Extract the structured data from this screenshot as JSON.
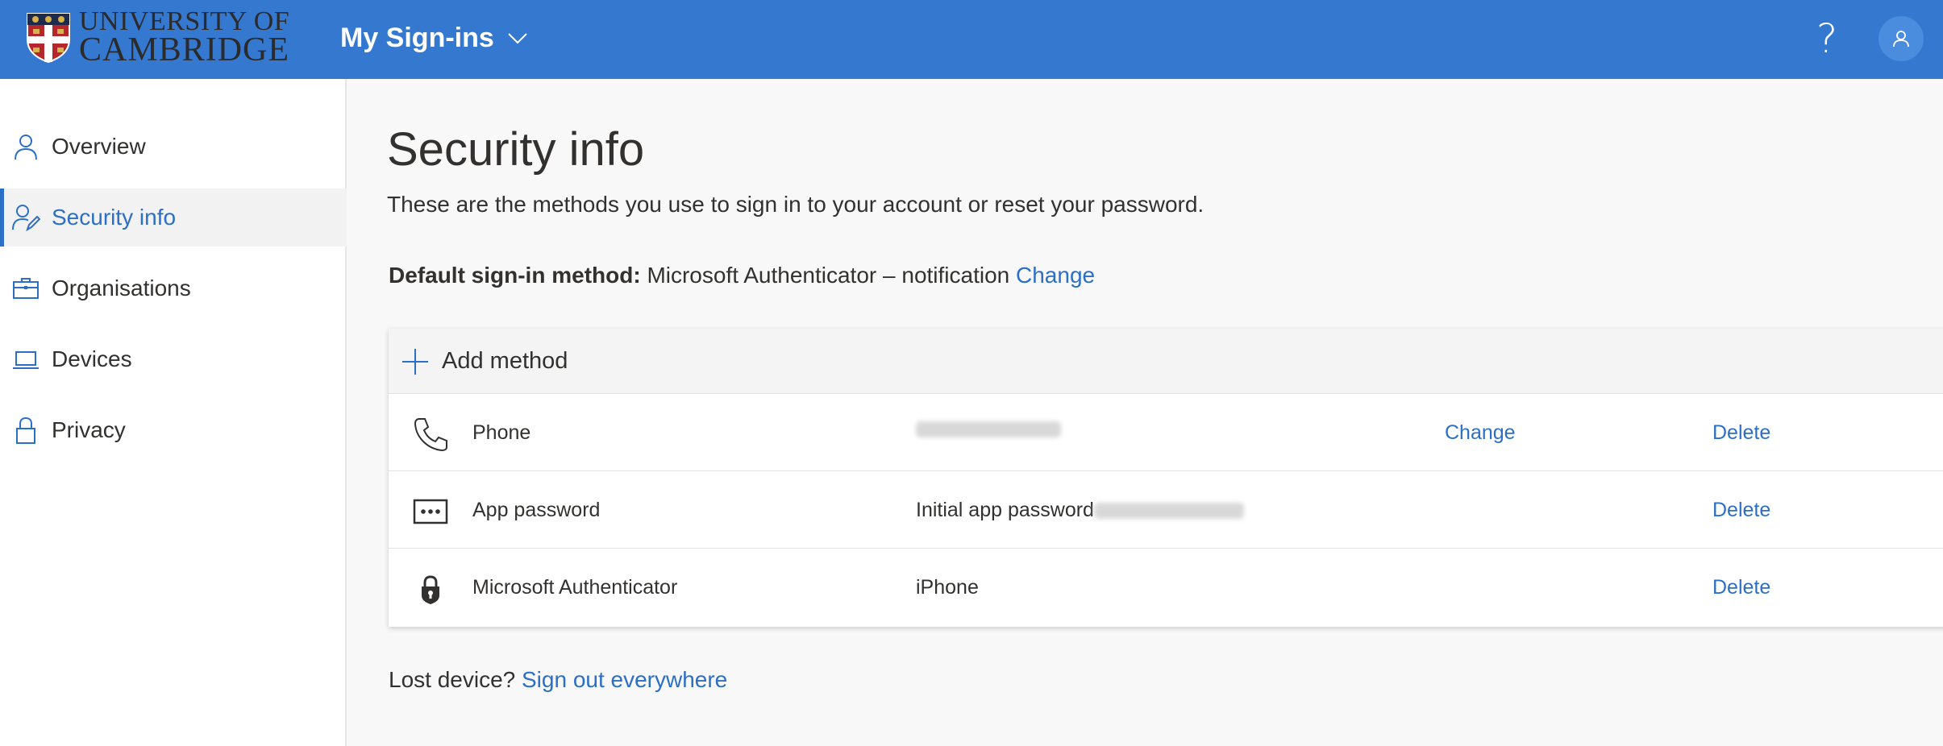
{
  "header": {
    "logo_line1": "UNIVERSITY OF",
    "logo_line2": "CAMBRIDGE",
    "app_title": "My Sign-ins",
    "help_label": "?",
    "colors": {
      "bar": "#3578d0",
      "accent": "#2b6fc7"
    }
  },
  "sidebar": {
    "items": [
      {
        "label": "Overview",
        "icon": "person-icon",
        "active": false
      },
      {
        "label": "Security info",
        "icon": "person-edit-icon",
        "active": true
      },
      {
        "label": "Organisations",
        "icon": "briefcase-icon",
        "active": false
      },
      {
        "label": "Devices",
        "icon": "laptop-icon",
        "active": false
      },
      {
        "label": "Privacy",
        "icon": "lock-icon",
        "active": false
      }
    ]
  },
  "main": {
    "title": "Security info",
    "description": "These are the methods you use to sign in to your account or reset your password.",
    "default_label": "Default sign-in method:",
    "default_value": "Microsoft Authenticator – notification",
    "default_change": "Change",
    "add_method": "Add method",
    "methods": [
      {
        "name": "Phone",
        "icon": "phone-icon",
        "detail": "",
        "change": "Change",
        "delete": "Delete"
      },
      {
        "name": "App password",
        "icon": "password-dots-icon",
        "detail": "Initial app password",
        "change": "",
        "delete": "Delete"
      },
      {
        "name": "Microsoft Authenticator",
        "icon": "authenticator-lock-icon",
        "detail": "iPhone",
        "change": "",
        "delete": "Delete"
      }
    ],
    "lost_prefix": "Lost device?",
    "lost_link": "Sign out everywhere"
  }
}
